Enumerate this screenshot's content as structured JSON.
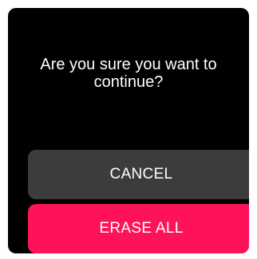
{
  "dialog": {
    "message": "Are you sure you want to continue?",
    "cancel_label": "CANCEL",
    "erase_label": "ERASE ALL"
  },
  "colors": {
    "background": "#000000",
    "cancel_button": "#3c3c3c",
    "erase_button": "#ff1358",
    "text": "#ffffff"
  }
}
